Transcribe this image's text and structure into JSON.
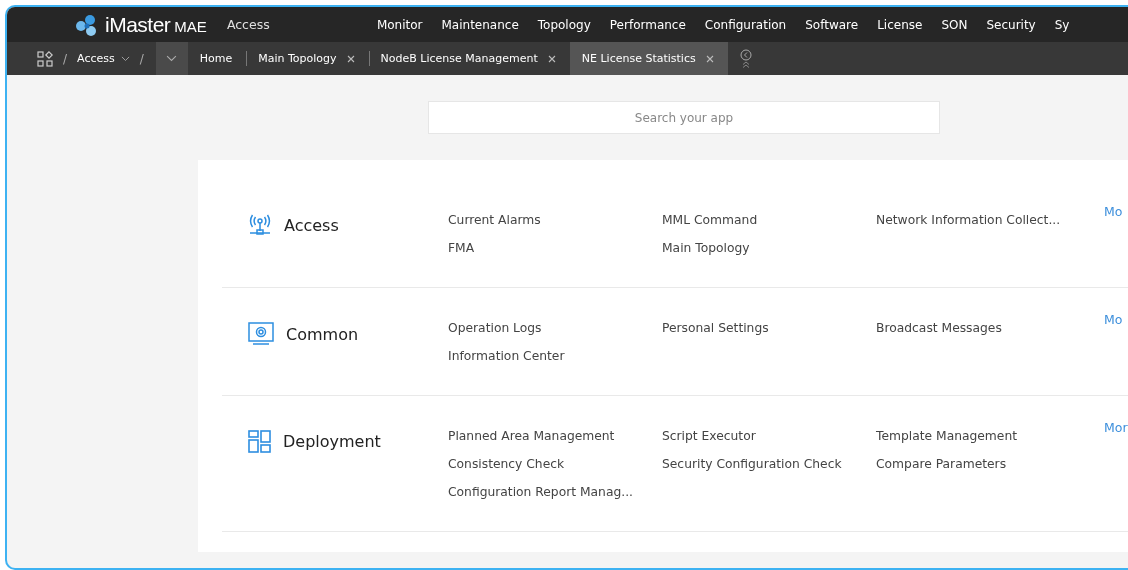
{
  "header": {
    "logo": {
      "brand": "iMaster",
      "product": "MAE"
    },
    "context": "Access",
    "menu": [
      "Monitor",
      "Maintenance",
      "Topology",
      "Performance",
      "Configuration",
      "Software",
      "License",
      "SON",
      "Security",
      "Sy"
    ]
  },
  "tabbar": {
    "separator": "/",
    "breadcrumb": [
      {
        "label": "Access",
        "dropdown": true
      }
    ],
    "tabs": [
      {
        "label": "Home",
        "closable": false,
        "selected": false
      },
      {
        "label": "Main Topology",
        "closable": true,
        "selected": false
      },
      {
        "label": "NodeB License Management",
        "closable": true,
        "selected": false
      },
      {
        "label": "NE License Statistics",
        "closable": true,
        "selected": true
      }
    ]
  },
  "search": {
    "placeholder": "Search your app"
  },
  "categories": [
    {
      "name": "Access",
      "kind": "antenna",
      "apps": [
        "Current Alarms",
        "MML Command",
        "Network Information Collect...",
        "FMA",
        "Main Topology"
      ],
      "more": "Mo"
    },
    {
      "name": "Common",
      "kind": "monitor",
      "apps": [
        "Operation Logs",
        "Personal Settings",
        "Broadcast Messages",
        "Information Center"
      ],
      "more": "Mo"
    },
    {
      "name": "Deployment",
      "kind": "grid",
      "apps": [
        "Planned Area Management",
        "Script Executor",
        "Template Management",
        "Consistency Check",
        "Security Configuration Check",
        "Compare Parameters",
        "Configuration Report Manag..."
      ],
      "more": "Mor"
    }
  ]
}
